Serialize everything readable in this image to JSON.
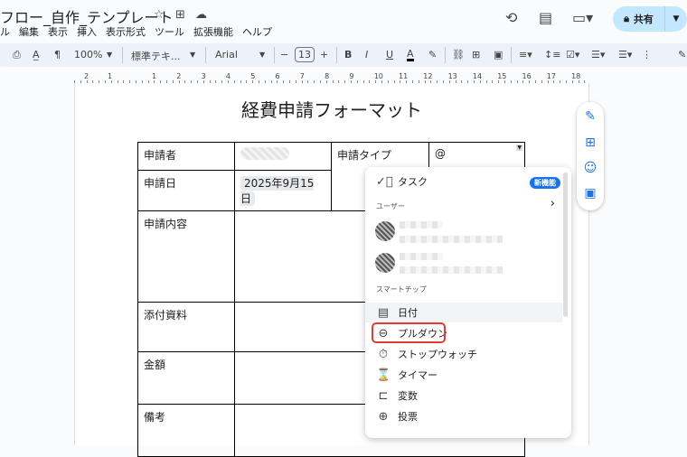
{
  "header": {
    "title": "フロー_自作_テンプレート",
    "share_label": "共有"
  },
  "menu": [
    "ル",
    "編集",
    "表示",
    "挿入",
    "表示形式",
    "ツール",
    "拡張機能",
    "ヘルプ"
  ],
  "toolbar": {
    "zoom": "100%",
    "style": "標準テキ...",
    "font": "Arial",
    "font_size": "13",
    "bold": "B",
    "italic": "I",
    "underline": "U",
    "text_color": "A"
  },
  "ruler": [
    "2",
    "1",
    "1",
    "2",
    "3",
    "4",
    "5",
    "6",
    "7",
    "8",
    "9",
    "10",
    "11",
    "12",
    "13",
    "14",
    "15",
    "16",
    "17",
    "18"
  ],
  "document": {
    "title": "経費申請フォーマット",
    "rows": [
      {
        "label": "申請者"
      },
      {
        "label": "申請日",
        "value": "2025年9月15日"
      },
      {
        "label": "申請内容"
      },
      {
        "label": "添付資料"
      },
      {
        "label": "金額"
      },
      {
        "label": "備考"
      }
    ],
    "type_label": "申請タイプ",
    "type_value": "@"
  },
  "popup": {
    "task": "タスク",
    "badge": "新機能",
    "users_header": "ユーザー",
    "smart_header": "スマートチップ",
    "items": [
      "日付",
      "プルダウン",
      "ストップウォッチ",
      "タイマー",
      "変数",
      "投票"
    ]
  },
  "colors": {
    "accent": "#1a73e8",
    "highlight": "#e53935",
    "share_bg": "#c2e7ff"
  }
}
